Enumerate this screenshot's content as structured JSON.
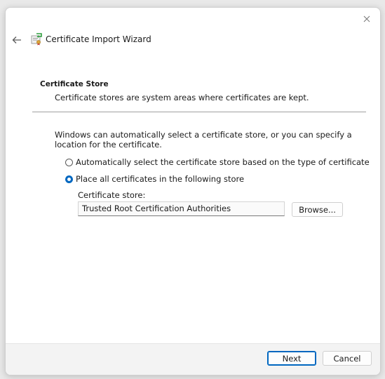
{
  "window": {
    "title": "Certificate Import Wizard"
  },
  "header": {
    "section_title": "Certificate Store",
    "section_desc": "Certificate stores are system areas where certificates are kept."
  },
  "body": {
    "intro": "Windows can automatically select a certificate store, or you can specify a location for the certificate.",
    "option_auto": "Automatically select the certificate store based on the type of certificate",
    "option_manual": "Place all certificates in the following store",
    "selected_option": "manual",
    "store_label": "Certificate store:",
    "store_value": "Trusted Root Certification Authorities",
    "browse_label": "Browse..."
  },
  "footer": {
    "next_label": "Next",
    "cancel_label": "Cancel"
  },
  "colors": {
    "accent": "#0067c0"
  },
  "icons": {
    "close": "close-icon",
    "back": "back-arrow-icon",
    "wizard": "certificate-wizard-icon"
  }
}
